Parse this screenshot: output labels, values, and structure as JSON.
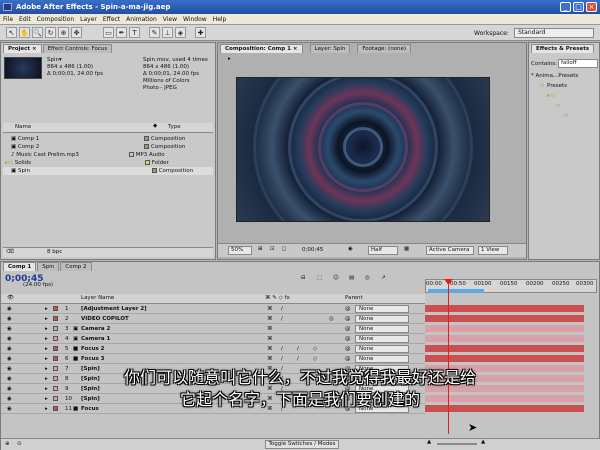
{
  "window": {
    "title": "Adobe After Effects - Spin-a-ma-jig.aep",
    "min": "_",
    "max": "□",
    "close": "×"
  },
  "menu": [
    "File",
    "Edit",
    "Composition",
    "Layer",
    "Effect",
    "Animation",
    "View",
    "Window",
    "Help"
  ],
  "toolbar": {
    "workspace_label": "Workspace:",
    "workspace_value": "Standard"
  },
  "project_panel": {
    "tab_project": "Project ×",
    "tab_effect_controls": "Effect Controls: Focus",
    "preview_name": "Spin▾",
    "preview_line1": "864 x 486 (1.00)",
    "preview_line2": "Δ 0;00;01, 24.00 fps",
    "info_name": "Spin.mov, used 4 times",
    "info_line1": "864 x 486 (1.00)",
    "info_line2": "Δ 0;00;01, 24.00 fps",
    "info_line3": "Millions of Colors",
    "info_line4": "Photo - JPEG",
    "col_name": "Name",
    "col_type": "Type",
    "items": [
      {
        "name": "Comp 1",
        "type": "Composition",
        "color": "#9a9a6a"
      },
      {
        "name": "Comp 2",
        "type": "Composition",
        "color": "#9a9a6a"
      },
      {
        "name": "Music Cast Prelim.mp3",
        "type": "MP3 Audio",
        "color": "#c8c8c8"
      },
      {
        "name": "Solids",
        "type": "Folder",
        "color": "#e8d84a"
      },
      {
        "name": "Spin",
        "type": "Composition",
        "color": "#9a9a6a"
      }
    ],
    "bpc": "8 bpc"
  },
  "viewer": {
    "tab_comp": "Composition: Comp 1 ×",
    "tab_layer": "Layer: Spin",
    "tab_footage": "Footage: (none)",
    "zoom": "50%",
    "timecode": "0;00;45",
    "resolution": "Half",
    "camera": "Active Camera",
    "views": "1 View"
  },
  "effects_panel": {
    "title": "Effects & Presets",
    "contains_label": "Contains:",
    "contains_value": "falloff",
    "tree_root": "* Anima...Presets",
    "tree_presets": "Presets"
  },
  "timeline": {
    "tabs": [
      "Comp 1",
      "Spin",
      "Comp 2"
    ],
    "timecode": "0;00;45",
    "fps": "(24.00 fps)",
    "col_layer_name": "Layer Name",
    "col_parent": "Parent",
    "ruler": [
      "00:00",
      "00:50",
      "00100",
      "00150",
      "00200",
      "00250",
      "00300"
    ],
    "toggle_label": "Toggle Switches / Modes",
    "layers": [
      {
        "num": "1",
        "name": "[Adjustment Layer 2]",
        "parent": "None",
        "color": "#c85050"
      },
      {
        "num": "2",
        "name": "VIDEO COPILOT",
        "parent": "None",
        "color": "#c85050"
      },
      {
        "num": "3",
        "name": "Camera 2",
        "parent": "None",
        "color": "#d8a0a8"
      },
      {
        "num": "4",
        "name": "Camera 1",
        "parent": "None",
        "color": "#d8a0a8"
      },
      {
        "num": "5",
        "name": "Focus 2",
        "parent": "None",
        "color": "#c85050"
      },
      {
        "num": "6",
        "name": "Focus 3",
        "parent": "None",
        "color": "#c85050"
      },
      {
        "num": "7",
        "name": "[Spin]",
        "parent": "None",
        "color": "#d8a0a8"
      },
      {
        "num": "8",
        "name": "[Spin]",
        "parent": "None",
        "color": "#d8a0a8"
      },
      {
        "num": "9",
        "name": "[Spin]",
        "parent": "None",
        "color": "#d8a0a8"
      },
      {
        "num": "10",
        "name": "[Spin]",
        "parent": "None",
        "color": "#d8a0a8"
      },
      {
        "num": "11",
        "name": "Focus",
        "parent": "None",
        "color": "#c85050"
      }
    ]
  },
  "subtitle": {
    "line1": "你们可以随意叫它什么，不过我觉得我最好还是给",
    "line2": "它起个名字，下面是我们要创建的"
  },
  "icons": {
    "selection": "↖",
    "hand": "✋",
    "zoom": "🔍",
    "rotate": "↻",
    "camera": "⊕",
    "pan": "✥",
    "rect": "▭",
    "pen": "✒",
    "text": "T",
    "brush": "✎",
    "stamp": "⊥",
    "eraser": "◈",
    "puppet": "✚",
    "eye": "👁",
    "expand": "▸"
  },
  "colors": {
    "accent": "#224fa0",
    "layer_red": "#c85050",
    "layer_pink": "#d8a0a8",
    "playhead": "#e02020"
  }
}
